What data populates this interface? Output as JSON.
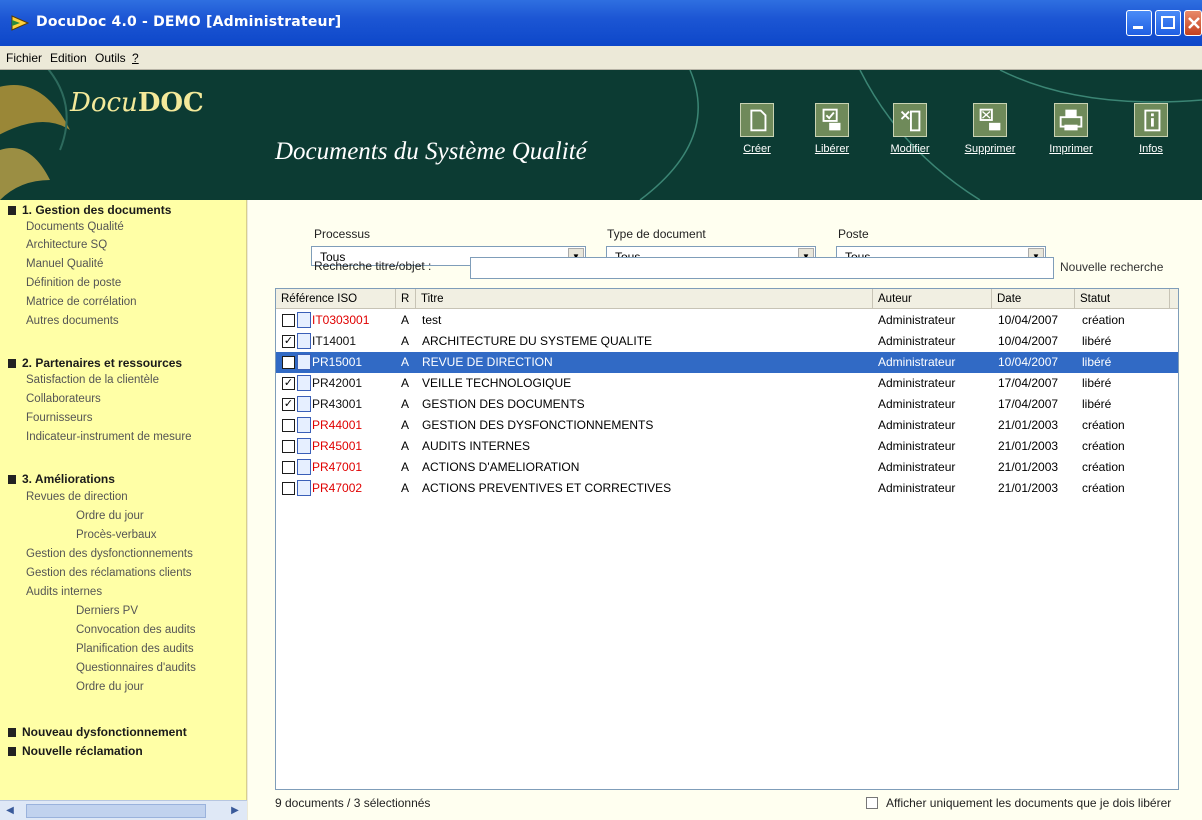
{
  "window": {
    "title": "DocuDoc 4.0 - DEMO [Administrateur]"
  },
  "menu": [
    "Fichier",
    "Edition",
    "Outils",
    "?"
  ],
  "banner": {
    "logo_pre": "Docu",
    "logo_post": "DOC",
    "title": "Documents du Système Qualité",
    "tools": [
      {
        "label": "Créer",
        "icon": "create-doc-icon"
      },
      {
        "label": "Libérer",
        "icon": "release-doc-icon"
      },
      {
        "label": "Modifier",
        "icon": "edit-doc-icon"
      },
      {
        "label": "Supprimer",
        "icon": "delete-doc-icon"
      },
      {
        "label": "Imprimer",
        "icon": "printer-icon"
      },
      {
        "label": "Infos",
        "icon": "info-icon"
      }
    ]
  },
  "nav": {
    "sections": [
      {
        "title": "1. Gestion des documents"
      },
      {
        "title": "2. Partenaires et ressources"
      },
      {
        "title": "3. Améliorations"
      },
      {
        "title": "Nouveau dysfonctionnement"
      },
      {
        "title": "Nouvelle réclamation"
      }
    ],
    "items": [
      "Documents Qualité",
      "Architecture SQ",
      "Manuel Qualité",
      "Définition de poste",
      "Matrice de corrélation",
      "Autres documents",
      "Satisfaction de la clientèle",
      "Collaborateurs",
      "Fournisseurs",
      "Indicateur-instrument de mesure",
      "Revues de direction",
      "Ordre du jour",
      "Procès-verbaux",
      "Gestion des dysfonctionnements",
      "Gestion des réclamations clients",
      "Audits internes",
      "Derniers PV",
      "Convocation des audits",
      "Planification des audits",
      "Questionnaires d'audits",
      "Ordre du jour"
    ]
  },
  "filters": {
    "processus_label": "Processus",
    "processus_value": "Tous",
    "type_label": "Type de document",
    "type_value": "Tous",
    "poste_label": "Poste",
    "poste_value": "Tous",
    "search_label": "Recherche titre/objet :",
    "search_value": "",
    "new_search": "Nouvelle recherche"
  },
  "table": {
    "headers": [
      "Référence ISO",
      "R",
      "Titre",
      "Auteur",
      "Date",
      "Statut"
    ],
    "rows": [
      {
        "checked": false,
        "ref": "IT0303001",
        "red": true,
        "r": "A",
        "titre": "test",
        "auteur": "Administrateur",
        "date": "10/04/2007",
        "statut": "création"
      },
      {
        "checked": true,
        "ref": "IT14001",
        "red": false,
        "r": "A",
        "titre": "ARCHITECTURE DU SYSTEME QUALITE",
        "auteur": "Administrateur",
        "date": "10/04/2007",
        "statut": "libéré"
      },
      {
        "checked": false,
        "ref": "PR15001",
        "red": false,
        "r": "A",
        "titre": "REVUE DE DIRECTION",
        "auteur": "Administrateur",
        "date": "10/04/2007",
        "statut": "libéré",
        "selected": true
      },
      {
        "checked": true,
        "ref": "PR42001",
        "red": false,
        "r": "A",
        "titre": "VEILLE TECHNOLOGIQUE",
        "auteur": "Administrateur",
        "date": "17/04/2007",
        "statut": "libéré"
      },
      {
        "checked": true,
        "ref": "PR43001",
        "red": false,
        "r": "A",
        "titre": "GESTION DES DOCUMENTS",
        "auteur": "Administrateur",
        "date": "17/04/2007",
        "statut": "libéré"
      },
      {
        "checked": false,
        "ref": "PR44001",
        "red": true,
        "r": "A",
        "titre": "GESTION DES DYSFONCTIONNEMENTS",
        "auteur": "Administrateur",
        "date": "21/01/2003",
        "statut": "création"
      },
      {
        "checked": false,
        "ref": "PR45001",
        "red": true,
        "r": "A",
        "titre": "AUDITS INTERNES",
        "auteur": "Administrateur",
        "date": "21/01/2003",
        "statut": "création"
      },
      {
        "checked": false,
        "ref": "PR47001",
        "red": true,
        "r": "A",
        "titre": "ACTIONS D'AMELIORATION",
        "auteur": "Administrateur",
        "date": "21/01/2003",
        "statut": "création"
      },
      {
        "checked": false,
        "ref": "PR47002",
        "red": true,
        "r": "A",
        "titre": "ACTIONS PREVENTIVES ET CORRECTIVES",
        "auteur": "Administrateur",
        "date": "21/01/2003",
        "statut": "création"
      }
    ]
  },
  "status": {
    "count_text": "9 documents / 3 sélectionnés",
    "filter_label": "Afficher uniquement les documents que je dois libérer"
  },
  "colors": {
    "banner": "#0c3b33",
    "nav": "#ffffa6",
    "selection": "#316ac5",
    "red_ref": "#e00000"
  }
}
